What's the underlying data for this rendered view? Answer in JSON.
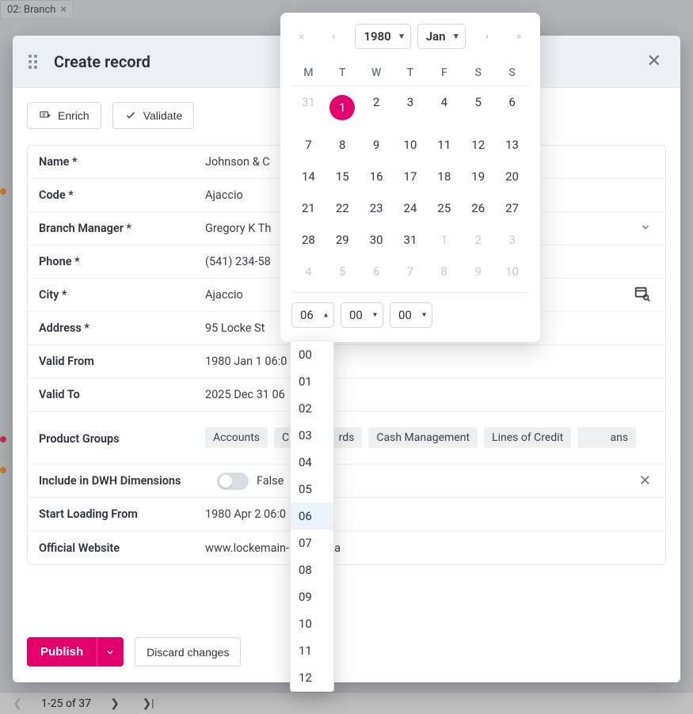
{
  "background": {
    "tab_label": "02: Branch",
    "pagination_text": "1-25 of 37"
  },
  "modal": {
    "title": "Create record",
    "actions": {
      "enrich": "Enrich",
      "validate": "Validate"
    },
    "footer": {
      "publish": "Publish",
      "discard": "Discard changes"
    }
  },
  "fields": {
    "name": {
      "label": "Name *",
      "value": "Johnson & C"
    },
    "code": {
      "label": "Code *",
      "value": "Ajaccio"
    },
    "manager": {
      "label": "Branch Manager *",
      "value": "Gregory K Th"
    },
    "phone": {
      "label": "Phone *",
      "value": "(541) 234-58"
    },
    "city": {
      "label": "City *",
      "value": "Ajaccio"
    },
    "address": {
      "label": "Address *",
      "value": "95 Locke St"
    },
    "valid_from": {
      "label": "Valid From",
      "value": "1980 Jan 1 06:0"
    },
    "valid_to": {
      "label": "Valid To",
      "value": "2025 Dec 31 06"
    },
    "product_groups": {
      "label": "Product Groups",
      "tags": [
        "Accounts",
        "C",
        "rds",
        "Cash Management",
        "Lines of Credit",
        "ans"
      ]
    },
    "dwh": {
      "label": "Include in DWH Dimensions",
      "value": "False"
    },
    "start_loading": {
      "label": "Start Loading From",
      "value": "1980 Apr 2 06:0"
    },
    "website": {
      "label": "Official Website",
      "value": "www.lockemain-",
      "value_suffix": "e.ca"
    }
  },
  "datepicker": {
    "year": "1980",
    "month": "Jan",
    "dow": [
      "M",
      "T",
      "W",
      "T",
      "F",
      "S",
      "S"
    ],
    "weeks": [
      [
        {
          "d": "31",
          "muted": true
        },
        {
          "d": "1",
          "selected": true
        },
        {
          "d": "2"
        },
        {
          "d": "3"
        },
        {
          "d": "4"
        },
        {
          "d": "5"
        },
        {
          "d": "6"
        }
      ],
      [
        {
          "d": "7"
        },
        {
          "d": "8"
        },
        {
          "d": "9"
        },
        {
          "d": "10"
        },
        {
          "d": "11"
        },
        {
          "d": "12"
        },
        {
          "d": "13"
        }
      ],
      [
        {
          "d": "14"
        },
        {
          "d": "15"
        },
        {
          "d": "16"
        },
        {
          "d": "17"
        },
        {
          "d": "18"
        },
        {
          "d": "19"
        },
        {
          "d": "20"
        }
      ],
      [
        {
          "d": "21"
        },
        {
          "d": "22"
        },
        {
          "d": "23"
        },
        {
          "d": "24"
        },
        {
          "d": "25"
        },
        {
          "d": "26"
        },
        {
          "d": "27"
        }
      ],
      [
        {
          "d": "28"
        },
        {
          "d": "29"
        },
        {
          "d": "30"
        },
        {
          "d": "31"
        },
        {
          "d": "1",
          "muted": true
        },
        {
          "d": "2",
          "muted": true
        },
        {
          "d": "3",
          "muted": true
        }
      ],
      [
        {
          "d": "4",
          "muted": true
        },
        {
          "d": "5",
          "muted": true
        },
        {
          "d": "6",
          "muted": true
        },
        {
          "d": "7",
          "muted": true
        },
        {
          "d": "8",
          "muted": true
        },
        {
          "d": "9",
          "muted": true
        },
        {
          "d": "10",
          "muted": true
        }
      ]
    ],
    "time": {
      "hours": "06",
      "minutes": "00",
      "seconds": "00"
    },
    "hour_options": [
      "00",
      "01",
      "02",
      "03",
      "04",
      "05",
      "06",
      "07",
      "08",
      "09",
      "10",
      "11",
      "12"
    ],
    "hour_selected": "06"
  }
}
